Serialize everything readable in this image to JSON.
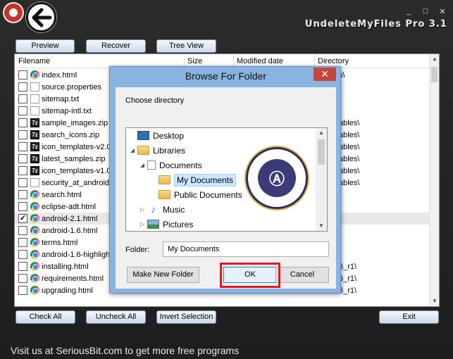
{
  "app": {
    "title": "UndeleteMyFiles Pro 3.1",
    "footer": "Visit us at SeriousBit.com to get more free programs",
    "window_controls": [
      "_",
      "□",
      "✕"
    ]
  },
  "toolbar": {
    "preview": "Preview",
    "recover": "Recover",
    "tree_view": "Tree View"
  },
  "columns": {
    "filename": "Filename",
    "size": "Size",
    "modified": "Modified date",
    "directory": "Directory"
  },
  "files": [
    {
      "name": "index.html",
      "icon": "chrome-icon",
      "checked": false,
      "dir": "s\\"
    },
    {
      "name": "source.properties",
      "icon": "text-file-icon",
      "checked": false,
      "dir": ""
    },
    {
      "name": "sitemap.txt",
      "icon": "text-file-icon",
      "checked": false,
      "dir": ""
    },
    {
      "name": "sitemap-intl.txt",
      "icon": "text-file-icon",
      "checked": false,
      "dir": ""
    },
    {
      "name": "sample_images.zip",
      "icon": "zip-icon",
      "checked": false,
      "dir": "ables\\"
    },
    {
      "name": "search_icons.zip",
      "icon": "zip-icon",
      "checked": false,
      "dir": "ables\\"
    },
    {
      "name": "icon_templates-v2.0",
      "icon": "zip-icon",
      "checked": false,
      "dir": "ables\\"
    },
    {
      "name": "latest_samples.zip",
      "icon": "zip-icon",
      "checked": false,
      "dir": "ables\\"
    },
    {
      "name": "icon_templates-v1.0",
      "icon": "zip-icon",
      "checked": false,
      "dir": "ables\\"
    },
    {
      "name": "security_at_android",
      "icon": "text-file-icon",
      "checked": false,
      "dir": "ables\\"
    },
    {
      "name": "search.html",
      "icon": "chrome-icon",
      "checked": false,
      "dir": ""
    },
    {
      "name": "eclipse-adt.html",
      "icon": "chrome-icon",
      "checked": false,
      "dir": ""
    },
    {
      "name": "android-2.1.html",
      "icon": "chrome-icon",
      "checked": true,
      "dir": ""
    },
    {
      "name": "android-1.6.html",
      "icon": "chrome-icon",
      "checked": false,
      "dir": ""
    },
    {
      "name": "terms.html",
      "icon": "chrome-icon",
      "checked": false,
      "dir": ""
    },
    {
      "name": "android-1.6-highligh",
      "icon": "chrome-icon",
      "checked": false,
      "dir": ""
    },
    {
      "name": "installing.html",
      "icon": "chrome-icon",
      "checked": false,
      "dir": "6_r1\\"
    },
    {
      "name": "requirements.html",
      "icon": "chrome-icon",
      "checked": false,
      "dir": "6_r1\\"
    },
    {
      "name": "upgrading.html",
      "icon": "chrome-icon",
      "checked": false,
      "dir": "6_r1\\"
    }
  ],
  "bottom": {
    "check_all": "Check All",
    "uncheck_all": "Uncheck All",
    "invert": "Invert Selection",
    "exit": "Exit"
  },
  "dialog": {
    "title": "Browse For Folder",
    "close": "✕",
    "prompt": "Choose directory",
    "tree": [
      {
        "label": "Desktop",
        "icon": "desktop-icon",
        "arrow": ""
      },
      {
        "label": "Libraries",
        "icon": "folder-icon",
        "arrow": "◢"
      },
      {
        "label": "Documents",
        "icon": "document-icon",
        "arrow": "◢"
      },
      {
        "label": "My Documents",
        "icon": "folder-icon",
        "arrow": "",
        "selected": true
      },
      {
        "label": "Public Documents",
        "icon": "folder-icon",
        "arrow": ""
      },
      {
        "label": "Music",
        "icon": "music-icon",
        "arrow": "▷"
      },
      {
        "label": "Pictures",
        "icon": "pictures-icon",
        "arrow": "▷"
      }
    ],
    "folder_label": "Folder:",
    "folder_value": "My Documents",
    "make_new_folder": "Make New Folder",
    "ok": "OK",
    "cancel": "Cancel",
    "highlight_color": "#e0191f"
  }
}
